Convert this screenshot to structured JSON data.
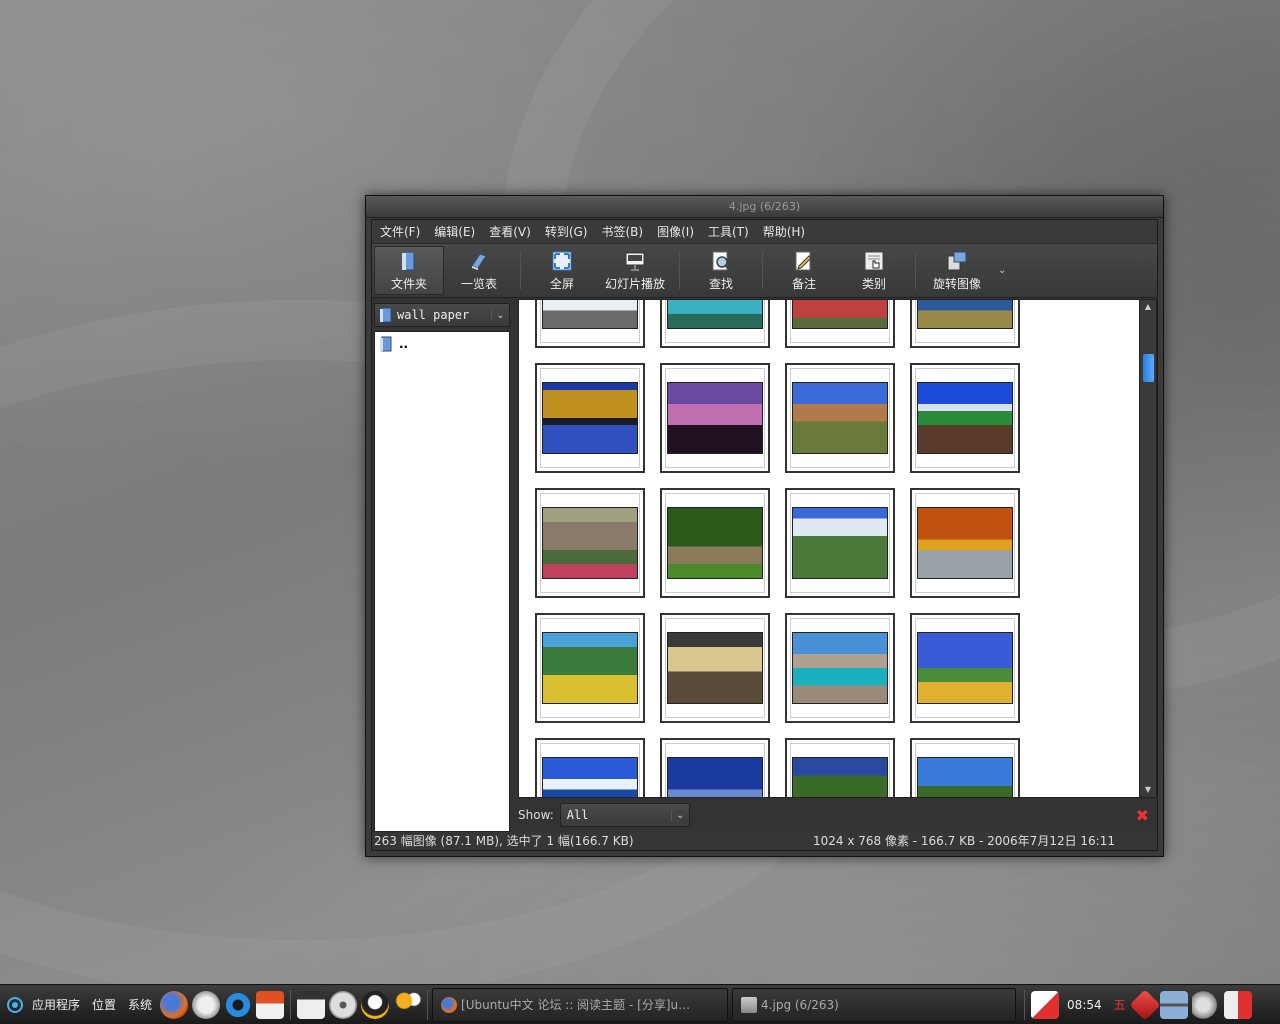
{
  "window": {
    "title": "4.jpg (6/263)"
  },
  "menu": [
    {
      "label": "文件(F)"
    },
    {
      "label": "编辑(E)"
    },
    {
      "label": "查看(V)"
    },
    {
      "label": "转到(G)"
    },
    {
      "label": "书签(B)"
    },
    {
      "label": "图像(I)"
    },
    {
      "label": "工具(T)"
    },
    {
      "label": "帮助(H)"
    }
  ],
  "toolbar": {
    "folders": "文件夹",
    "catalogs": "一览表",
    "fullscreen": "全屏",
    "slideshow": "幻灯片播放",
    "find": "查找",
    "comment": "备注",
    "categories": "类别",
    "rotate": "旋转图像"
  },
  "folder_combo": {
    "value": "wall paper"
  },
  "dir_list": [
    {
      "name": ".."
    }
  ],
  "show": {
    "label": "Show:",
    "value": "All"
  },
  "status": {
    "left": "263 幅图像 (87.1 MB), 选中了 1 幅(166.7 KB)",
    "right": "1024 x 768 像素 - 166.7 KB - 2006年7月12日 16:11"
  },
  "panel": {
    "applications": "应用程序",
    "places": "位置",
    "system": "系统",
    "task1": "[Ubuntu中文 论坛 :: 阅读主题 - [分享]u…",
    "task2": "4.jpg (6/263)",
    "clock": "08:54",
    "day": "五"
  },
  "colors": {
    "accent": "#3a8fe8",
    "close": "#e33333"
  }
}
